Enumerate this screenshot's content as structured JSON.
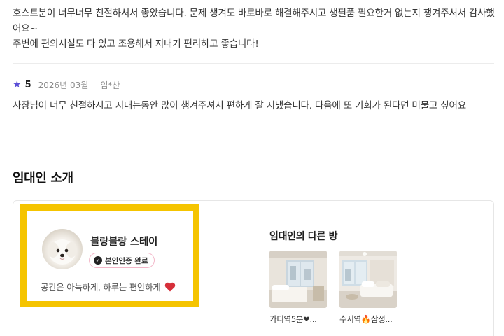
{
  "reviews": [
    {
      "text": "호스트분이 너무너무 친절하셔서 좋았습니다. 문제 생겨도 바로바로 해결해주시고 생필품 필요한거 없는지 챙겨주셔서 감사했어요~\n주변에 편의시설도 다 있고 조용해서 지내기 편리하고 좋습니다!"
    },
    {
      "rating": "5",
      "date": "2026년 03월",
      "author": "임*산",
      "text": "사장님이 너무 친절하시고 지내는동안 많이 챙겨주셔서 편하게 잘 지냈습니다. 다음에 또 기회가 된다면 머물고 싶어요"
    }
  ],
  "host_section": {
    "title": "임대인 소개",
    "host": {
      "name": "블랑블랑 스테이",
      "verified_label": "본인인증 완료",
      "intro": "공간은 아늑하게, 하루는 편안하게"
    },
    "other_rooms_title": "임대인의 다른 방",
    "other_rooms": [
      {
        "label": "가디역5분❤..."
      },
      {
        "label": "수서역🔥삼성..."
      }
    ]
  },
  "colors": {
    "star": "#5b4fd6",
    "highlight_border": "#f5c400",
    "heart": "#d62f3a",
    "badge_border": "#f3b6c8"
  }
}
